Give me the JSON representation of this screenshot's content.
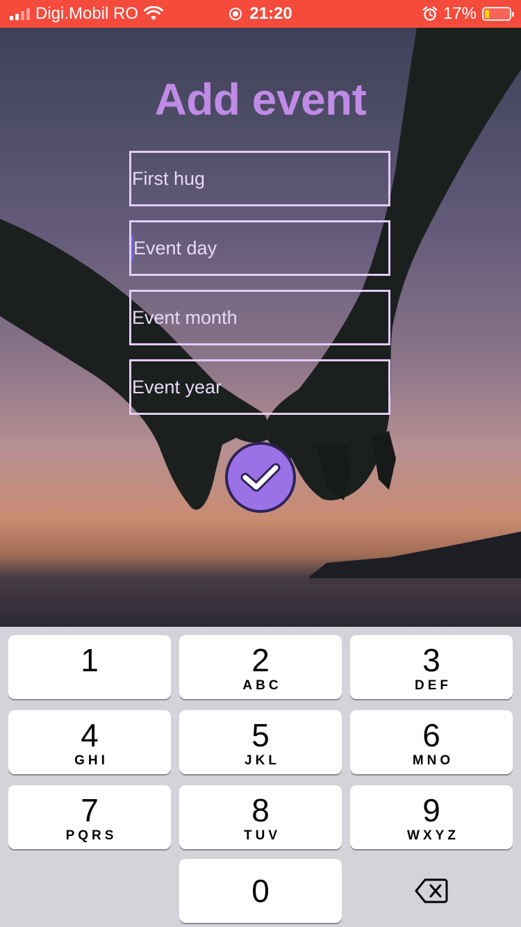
{
  "status_bar": {
    "carrier": "Digi.Mobil RO",
    "time": "21:20",
    "battery_percent": "17%",
    "battery_level": 0.17,
    "icons": [
      "signal-icon",
      "wifi-icon",
      "location-icon",
      "alarm-icon",
      "battery-icon"
    ],
    "background_color": "#f54b3c"
  },
  "screen": {
    "title": "Add event",
    "title_color": "#c08be6",
    "fields": [
      {
        "placeholder": "First hug",
        "value": "",
        "focused": false
      },
      {
        "placeholder": "Event day",
        "value": "",
        "focused": true
      },
      {
        "placeholder": "Event month",
        "value": "",
        "focused": false
      },
      {
        "placeholder": "Event year",
        "value": "",
        "focused": false
      }
    ],
    "confirm_icon": "check-icon",
    "confirm_color": "#9a72e6"
  },
  "keypad": {
    "keys": [
      {
        "num": "1",
        "letters": ""
      },
      {
        "num": "2",
        "letters": "ABC"
      },
      {
        "num": "3",
        "letters": "DEF"
      },
      {
        "num": "4",
        "letters": "GHI"
      },
      {
        "num": "5",
        "letters": "JKL"
      },
      {
        "num": "6",
        "letters": "MNO"
      },
      {
        "num": "7",
        "letters": "PQRS"
      },
      {
        "num": "8",
        "letters": "TUV"
      },
      {
        "num": "9",
        "letters": "WXYZ"
      },
      {
        "num": "0",
        "letters": ""
      }
    ],
    "delete_icon": "backspace-icon"
  }
}
